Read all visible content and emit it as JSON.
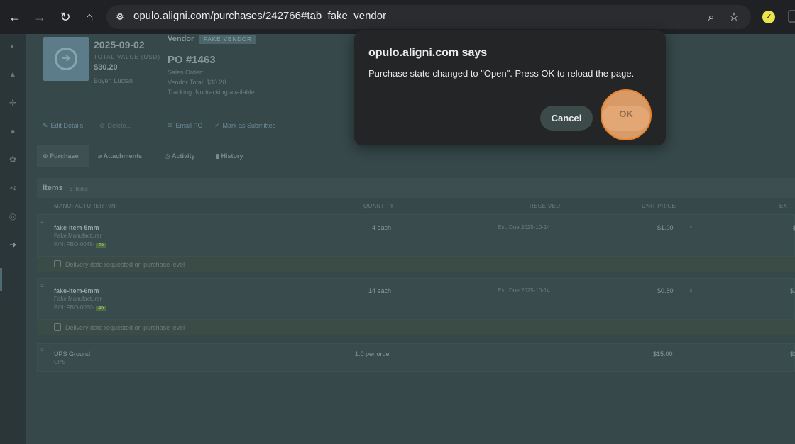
{
  "browser": {
    "url": "opulo.aligni.com/purchases/242766#tab_fake_vendor"
  },
  "purchase": {
    "date": "2025-09-02",
    "total_value_label": "TOTAL VALUE (USD)",
    "total_value": "$30.20",
    "buyer": "Buyer: Lucian",
    "vendor_label": "Vendor",
    "vendor_badge": "FAKE VENDOR",
    "po_number": "PO #1463",
    "sales_order": "Sales Order:",
    "vendor_total": "Vendor Total: $30.20",
    "tracking": "Tracking: No tracking available"
  },
  "actions": {
    "edit_details": "Edit Details",
    "delete": "Delete...",
    "email_po": "Email PO",
    "mark_submitted": "Mark as Submitted"
  },
  "tabs": [
    "Purchase",
    "Attachments",
    "Activity",
    "History"
  ],
  "items": {
    "title": "Items",
    "count": "3 items",
    "columns": {
      "manufacturer_pn": "MANUFACTURER P/N",
      "quantity": "QUANTITY",
      "received": "RECEIVED",
      "unit_price": "UNIT PRICE",
      "ext": "EXT."
    },
    "rows": [
      {
        "name": "fake-item-5mm",
        "manufacturer": "Fake Manufacturer",
        "pn": "P/N: FBO-0049-",
        "pn_tag": "45",
        "quantity": "4 each",
        "received": "Est. Due 2025-10-14",
        "unit_price": "$1.00",
        "x": "×",
        "ext": "$"
      },
      {
        "name": "fake-item-6mm",
        "manufacturer": "Fake Manufacturer",
        "pn": "P/N: FBO-0050-",
        "pn_tag": "46",
        "quantity": "14 each",
        "received": "Est. Due 2025-10-14",
        "unit_price": "$0.80",
        "x": "×",
        "ext": "$1"
      }
    ],
    "delivery_note": "Delivery date requested on purchase level",
    "shipping": {
      "name": "UPS Ground",
      "sub": "UPS",
      "quantity": "1.0 per order",
      "unit_price": "$15.00",
      "ext": "$1"
    }
  },
  "dialog": {
    "title": "opulo.aligni.com says",
    "message": "Purchase state changed to \"Open\". Press OK to reload the page.",
    "cancel": "Cancel",
    "ok": "OK"
  }
}
